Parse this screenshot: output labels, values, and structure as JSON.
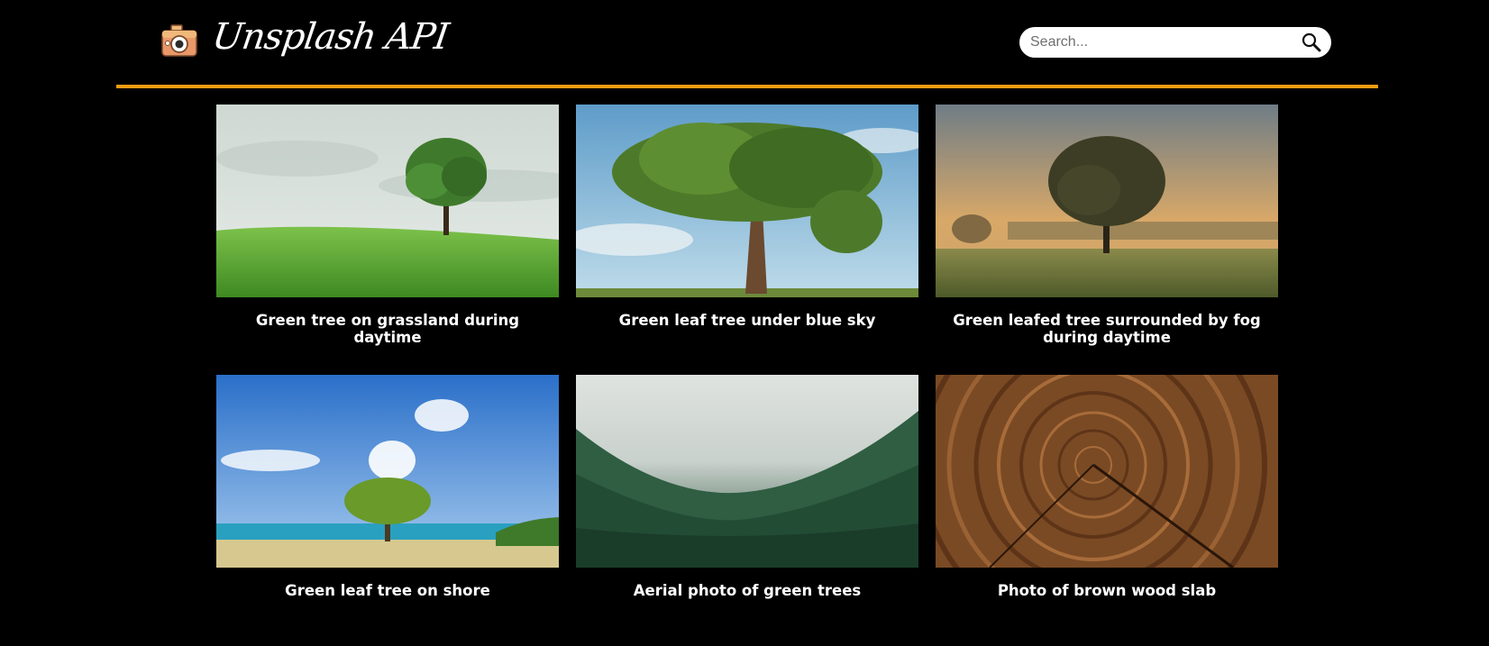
{
  "header": {
    "logo_text": "Unsplash API",
    "logo_icon": "camera-icon",
    "search": {
      "placeholder": "Search...",
      "value": "",
      "icon": "search-icon"
    }
  },
  "colors": {
    "accent": "#f39c12",
    "background": "#000000",
    "caption": "#ffffff"
  },
  "gallery": {
    "items": [
      {
        "caption": "Green tree on grassland during daytime"
      },
      {
        "caption": "Green leaf tree under blue sky"
      },
      {
        "caption": "Green leafed tree surrounded by fog during daytime"
      },
      {
        "caption": "Green leaf tree on shore"
      },
      {
        "caption": "Aerial photo of green trees"
      },
      {
        "caption": "Photo of brown wood slab"
      }
    ]
  }
}
